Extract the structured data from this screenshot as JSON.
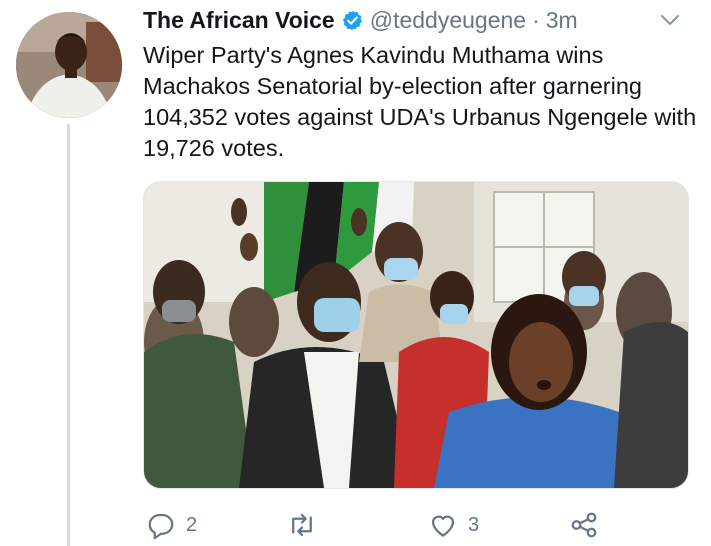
{
  "tweet": {
    "display_name": "The African Voice",
    "handle": "@teddyeugene",
    "separator": "·",
    "time": "3m",
    "text": "Wiper Party's Agnes Kavindu Muthama wins Machakos Senatorial by-election after garnering 104,352 votes against UDA's Urbanus Ngengele with 19,726 votes.",
    "verified": true,
    "icons": {
      "verified": "verified-badge-icon",
      "more": "chevron-down-icon",
      "reply": "reply-icon",
      "retweet": "retweet-icon",
      "like": "heart-icon",
      "share": "share-icon"
    }
  },
  "actions": {
    "reply_count": "2",
    "retweet_count": "",
    "like_count": "3"
  },
  "colors": {
    "verified": "#1da1f2",
    "secondary_text": "#657786",
    "thread_line": "#d6dde2"
  }
}
